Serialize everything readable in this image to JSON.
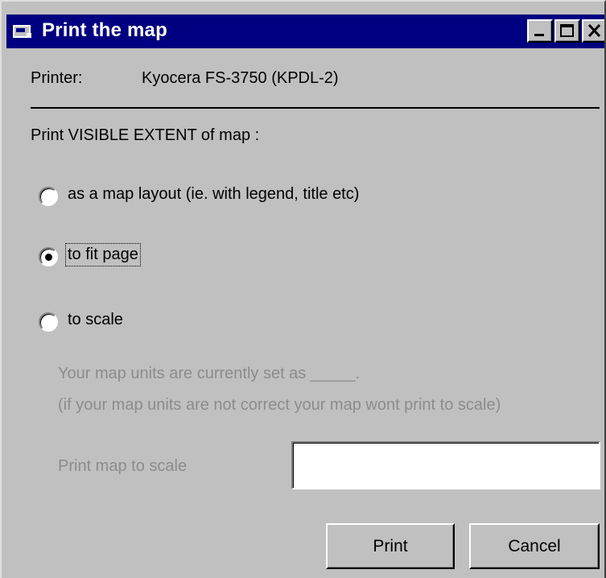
{
  "window": {
    "title": "Print the map",
    "icon": "app-icon",
    "controls": {
      "minimize": "minimize-icon",
      "maximize": "maximize-icon",
      "close": "close-icon"
    }
  },
  "printer": {
    "label": "Printer:",
    "value": "Kyocera FS-3750 (KPDL-2)"
  },
  "section_heading": "Print VISIBLE EXTENT of map :",
  "options": [
    {
      "label": "as a map layout (ie. with legend, title etc)",
      "selected": false
    },
    {
      "label": "to fit page",
      "selected": true
    },
    {
      "label": "to scale",
      "selected": false
    }
  ],
  "scale": {
    "units_note": "Your map units are currently set as _____.",
    "units_warning": "(if your map units are not correct your map wont print to scale)",
    "label": "Print map to scale",
    "value": "",
    "disabled": true
  },
  "buttons": {
    "print": "Print",
    "cancel": "Cancel"
  },
  "colors": {
    "titlebar": "#000080",
    "face": "#c0c0c0",
    "disabled_text": "#8c8c8c"
  }
}
